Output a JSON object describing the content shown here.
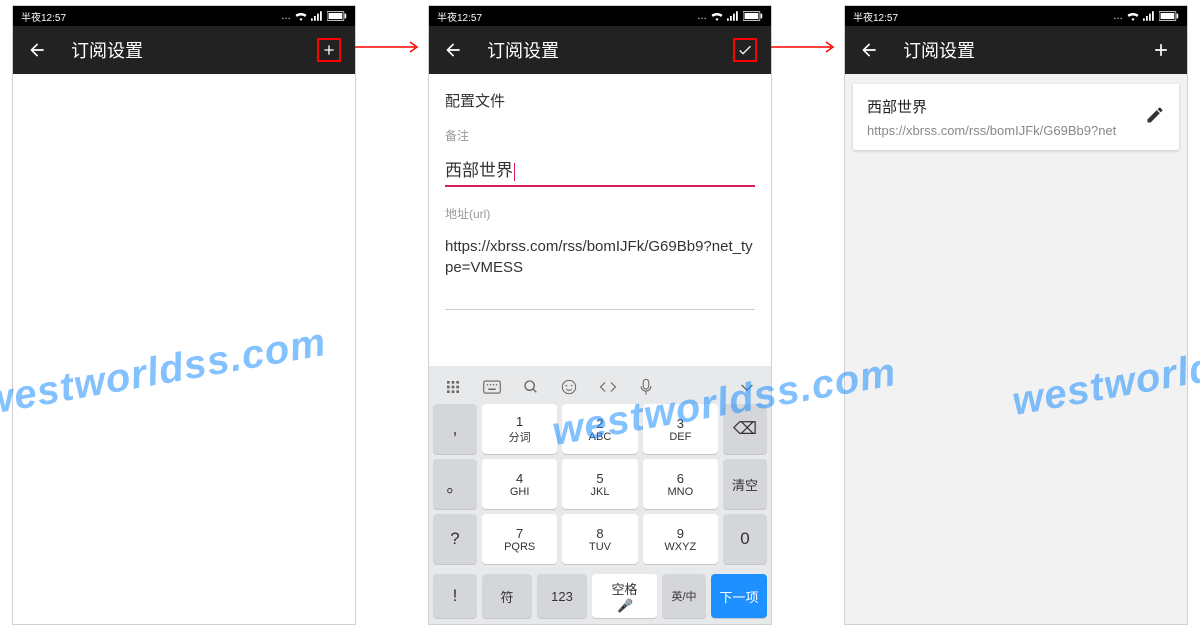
{
  "status": {
    "time_label": "半夜12:57",
    "dots": "…"
  },
  "appbar": {
    "title": "订阅设置"
  },
  "screen2": {
    "section": "配置文件",
    "remark_label": "备注",
    "remark_value": "西部世界",
    "url_label": "地址(url)",
    "url_value": "https://xbrss.com/rss/bomIJFk/G69Bb9?net_type=VMESS"
  },
  "keyboard": {
    "row1": [
      {
        "n": "1",
        "l": "分词"
      },
      {
        "n": "2",
        "l": "ABC"
      },
      {
        "n": "3",
        "l": "DEF"
      }
    ],
    "row2": [
      {
        "n": "4",
        "l": "GHI"
      },
      {
        "n": "5",
        "l": "JKL"
      },
      {
        "n": "6",
        "l": "MNO"
      }
    ],
    "row3": [
      {
        "n": "7",
        "l": "PQRS"
      },
      {
        "n": "8",
        "l": "TUV"
      },
      {
        "n": "9",
        "l": "WXYZ"
      }
    ],
    "side_left": [
      ",",
      "。",
      "?",
      "!"
    ],
    "side_right_del": "⌫",
    "side_right_clear": "清空",
    "side_right_zero": "0",
    "bottom": {
      "sym": "符",
      "num": "123",
      "space": "空格",
      "lang": "英/中",
      "next": "下一项"
    }
  },
  "screen3": {
    "card_title": "西部世界",
    "card_url": "https://xbrss.com/rss/bomIJFk/G69Bb9?net"
  },
  "watermark": "westworldss.com"
}
